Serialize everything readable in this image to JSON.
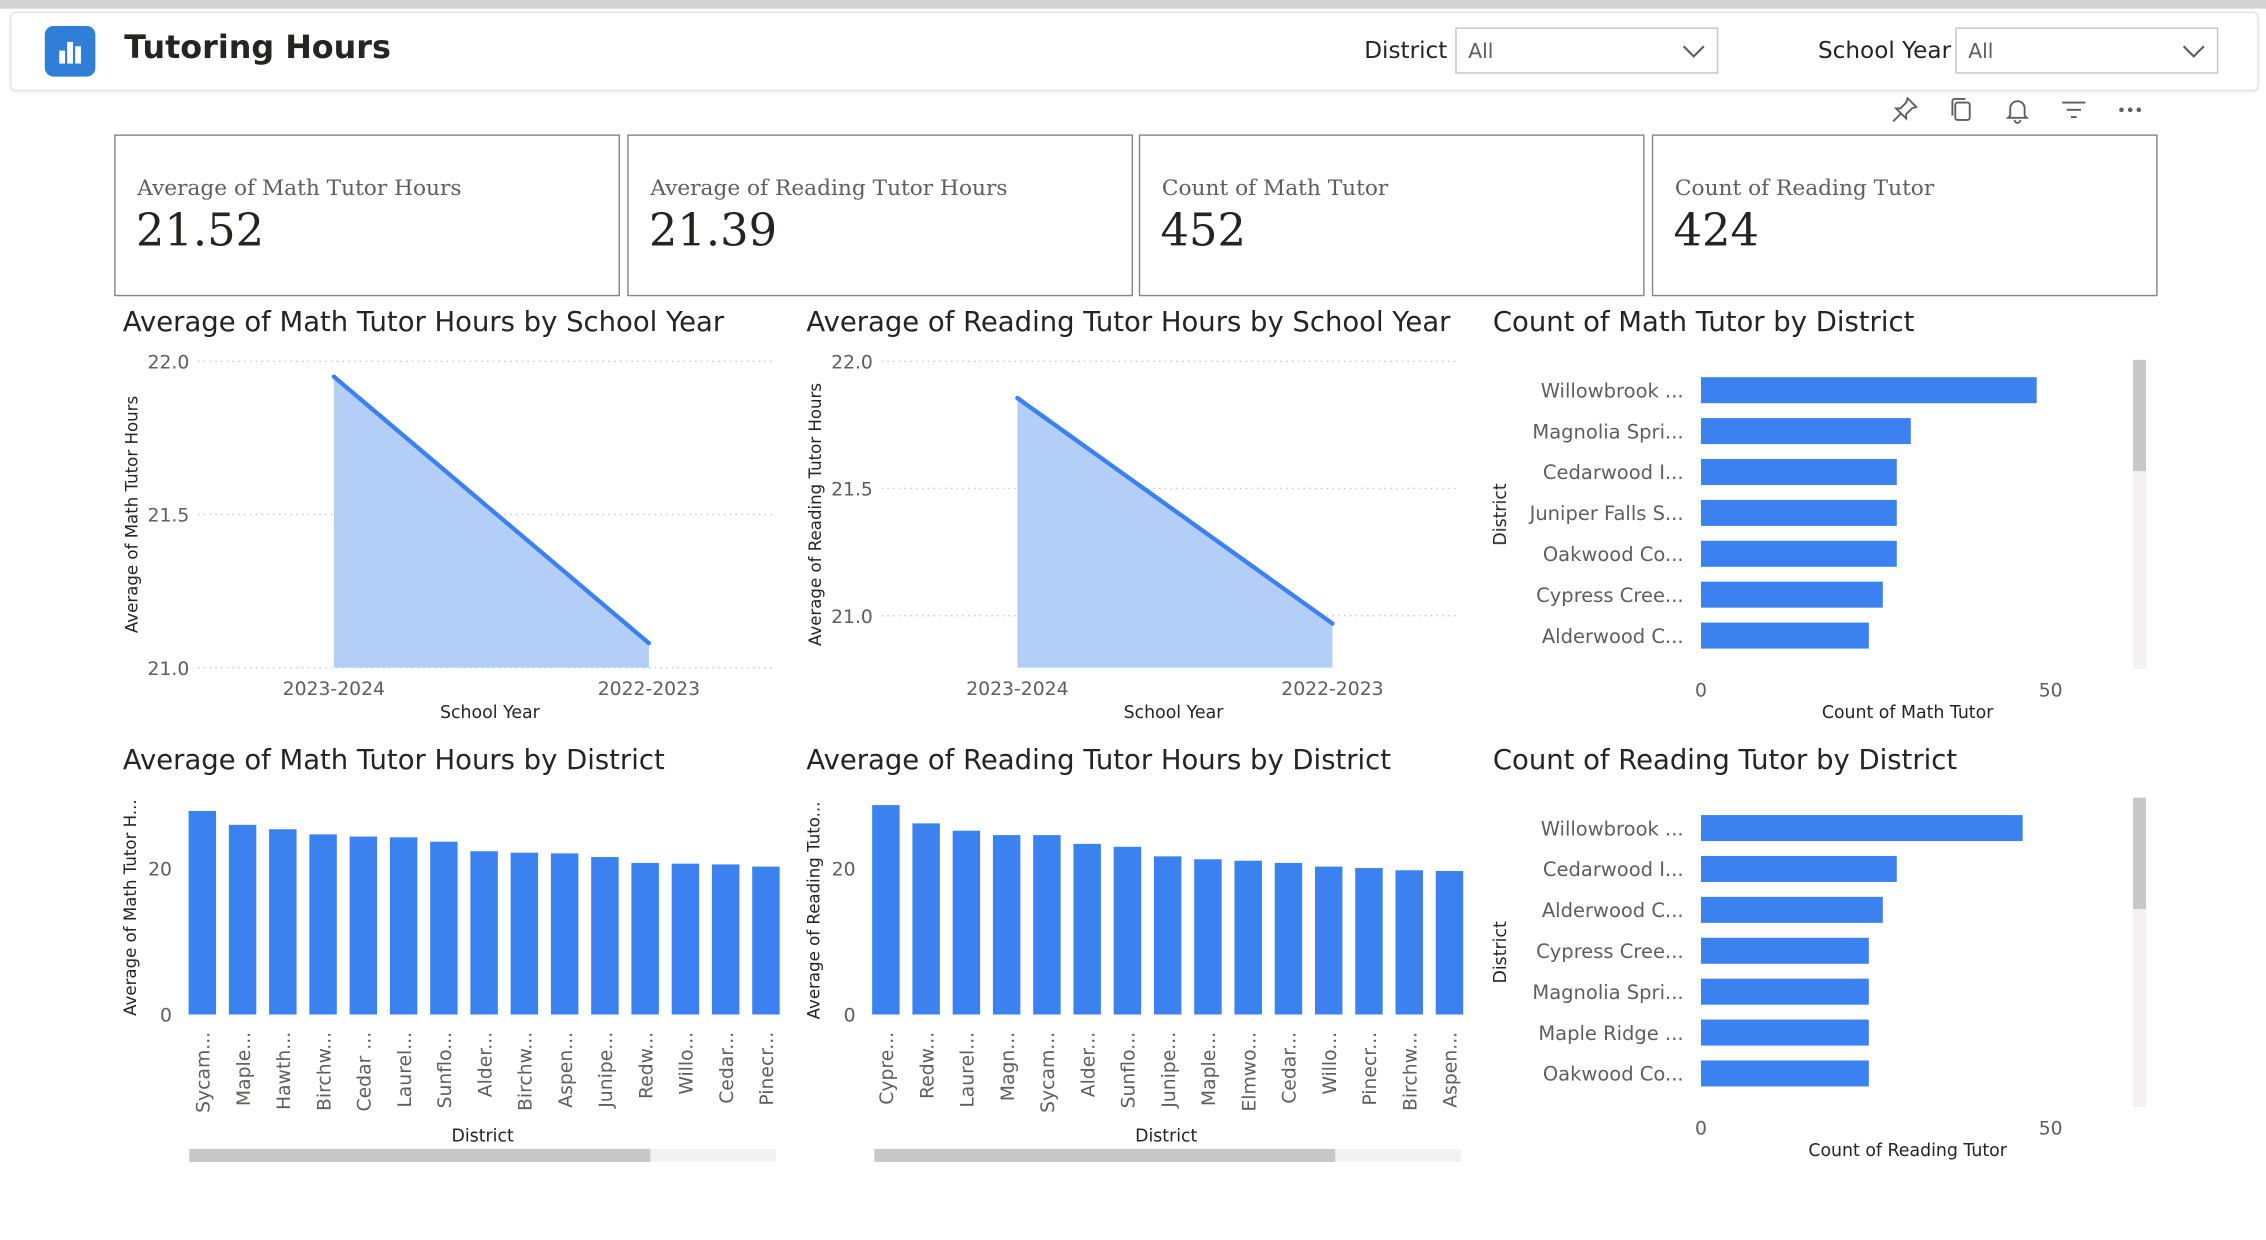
{
  "app": {
    "title": "Tutoring Hours",
    "icon": "bar-chart-icon",
    "accent": "#2f7fd8"
  },
  "filters": {
    "district_label": "District",
    "district_value": "All",
    "school_year_label": "School Year",
    "school_year_value": "All"
  },
  "toolbar": {
    "icons": [
      "pin-icon",
      "copy-icon",
      "bell-icon",
      "filter-icon",
      "more-icon"
    ]
  },
  "cards": [
    {
      "label": "Average of Math Tutor Hours",
      "value": "21.52"
    },
    {
      "label": "Average of Reading Tutor Hours",
      "value": "21.39"
    },
    {
      "label": "Count of Math Tutor",
      "value": "452"
    },
    {
      "label": "Count of Reading Tutor",
      "value": "424"
    }
  ],
  "colors": {
    "bar": "#3b82f0",
    "area_fill": "#b3cff7",
    "area_line": "#3b82f0",
    "grid": "#c8c8c8",
    "scrollbar": "#c8c8c8"
  },
  "chart_data": [
    {
      "id": "math_by_year",
      "type": "area",
      "title": "Average of Math Tutor Hours by School Year",
      "xlabel": "School Year",
      "ylabel": "Average of Math Tutor Hours",
      "categories": [
        "2023-2024",
        "2022-2023"
      ],
      "values": [
        21.95,
        21.08
      ],
      "ylim": [
        21.0,
        22.0
      ],
      "yticks": [
        "21.0",
        "21.5",
        "22.0"
      ],
      "grid": true
    },
    {
      "id": "reading_by_year",
      "type": "area",
      "title": "Average of Reading Tutor Hours by School Year",
      "xlabel": "School Year",
      "ylabel": "Average of Reading Tutor Hours",
      "categories": [
        "2023-2024",
        "2022-2023"
      ],
      "values": [
        21.85,
        20.93
      ],
      "ylim": [
        20.75,
        22.0
      ],
      "yticks": [
        "21.0",
        "21.5",
        "22.0"
      ],
      "grid": true
    },
    {
      "id": "math_count_by_district",
      "type": "bar",
      "orientation": "horizontal",
      "title": "Count of Math Tutor by District",
      "xlabel": "Count of Math Tutor",
      "ylabel": "District",
      "categories": [
        "Willowbrook ...",
        "Magnolia Spri...",
        "Cedarwood I...",
        "Juniper Falls S...",
        "Oakwood Co...",
        "Cypress Cree...",
        "Alderwood C..."
      ],
      "values": [
        48,
        30,
        28,
        28,
        28,
        26,
        24
      ],
      "xlim": [
        0,
        56
      ],
      "xticks": [
        "0",
        "50"
      ],
      "grid": false
    },
    {
      "id": "math_avg_by_district",
      "type": "bar",
      "orientation": "vertical",
      "title": "Average of Math Tutor Hours by District",
      "xlabel": "District",
      "ylabel": "Average of Math Tutor H...",
      "categories": [
        "Sycam...",
        "Maple...",
        "Hawth...",
        "Birchw...",
        "Cedar ...",
        "Laurel...",
        "Sunflo...",
        "Alder...",
        "Birchw...",
        "Aspen...",
        "Junipe...",
        "Redw...",
        "Willo...",
        "Cedar...",
        "Pinecr..."
      ],
      "values": [
        27.8,
        25.9,
        25.3,
        24.6,
        24.3,
        24.2,
        23.6,
        22.3,
        22.1,
        22.0,
        21.5,
        20.7,
        20.6,
        20.5,
        20.2
      ],
      "ylim": [
        0,
        30
      ],
      "yticks": [
        "0",
        "20"
      ],
      "grid": false
    },
    {
      "id": "reading_avg_by_district",
      "type": "bar",
      "orientation": "vertical",
      "title": "Average of Reading Tutor Hours by District",
      "xlabel": "District",
      "ylabel": "Average of Reading Tuto...",
      "categories": [
        "Cypre...",
        "Redw...",
        "Laurel...",
        "Magn...",
        "Sycam...",
        "Alder...",
        "Sunflo...",
        "Junipe...",
        "Maple...",
        "Elmwo...",
        "Cedar...",
        "Willo...",
        "Pinecr...",
        "Birchw...",
        "Aspen..."
      ],
      "values": [
        28.6,
        26.1,
        25.1,
        24.5,
        24.5,
        23.3,
        22.9,
        21.6,
        21.2,
        21.0,
        20.7,
        20.2,
        20.0,
        19.7,
        19.6
      ],
      "ylim": [
        0,
        30
      ],
      "yticks": [
        "0",
        "20"
      ],
      "grid": false
    },
    {
      "id": "reading_count_by_district",
      "type": "bar",
      "orientation": "horizontal",
      "title": "Count of Reading Tutor by District",
      "xlabel": "Count of Reading Tutor",
      "ylabel": "District",
      "categories": [
        "Willowbrook ...",
        "Cedarwood I...",
        "Alderwood C...",
        "Cypress Cree...",
        "Magnolia Spri...",
        "Maple Ridge ...",
        "Oakwood Co..."
      ],
      "values": [
        46,
        28,
        26,
        24,
        24,
        24,
        24
      ],
      "xlim": [
        0,
        56
      ],
      "xticks": [
        "0",
        "50"
      ],
      "grid": false
    }
  ]
}
